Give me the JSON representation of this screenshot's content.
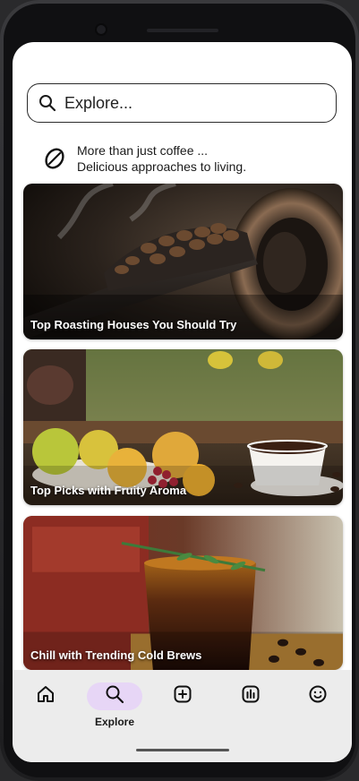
{
  "search": {
    "placeholder": "Explore...",
    "icon": "search-icon"
  },
  "tagline": {
    "icon": "coffee-bean-icon",
    "line1": "More than just coffee ...",
    "line2": "Delicious approaches to living."
  },
  "cards": [
    {
      "title": "Top Roasting Houses You Should Try",
      "image": "coffee-roaster-image"
    },
    {
      "title": "Top Picks with Fruity Aroma",
      "image": "fruit-and-coffee-image"
    },
    {
      "title": "Chill with Trending Cold Brews",
      "image": "cold-brew-image"
    }
  ],
  "nav": {
    "items": [
      {
        "icon": "home-icon",
        "label": ""
      },
      {
        "icon": "search-icon",
        "label": "Explore",
        "active": true
      },
      {
        "icon": "add-icon",
        "label": ""
      },
      {
        "icon": "stats-icon",
        "label": ""
      },
      {
        "icon": "profile-smile-icon",
        "label": ""
      }
    ],
    "active_color": "#e7d6f6"
  }
}
